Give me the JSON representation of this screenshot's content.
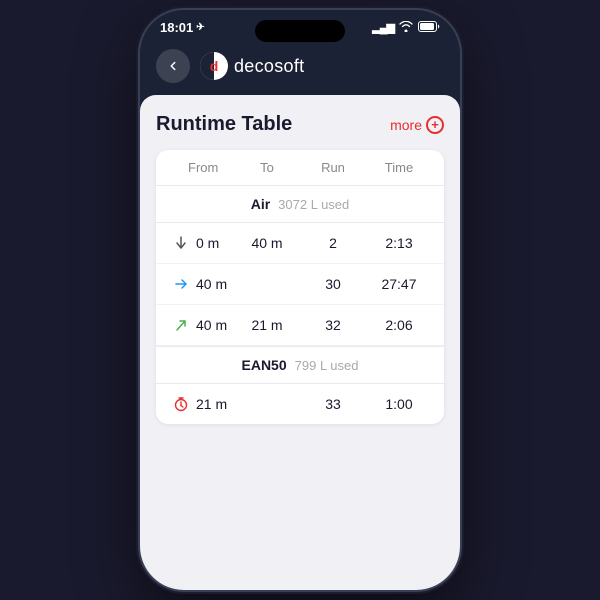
{
  "statusBar": {
    "time": "18:01",
    "timeIcon": "→",
    "signalBars": "▂▄▆",
    "wifi": "wifi",
    "battery": "battery"
  },
  "navBar": {
    "backLabel": "←",
    "logoText": "d",
    "appName": "decosoft"
  },
  "page": {
    "title": "Runtime Table",
    "moreLabel": "more",
    "morePlusIcon": "+"
  },
  "tableHeaders": {
    "col1": "From",
    "col2": "To",
    "col3": "Run",
    "col4": "Time"
  },
  "sections": [
    {
      "id": "air",
      "sectionLabel": "Air",
      "sectionSub": "3072 L used",
      "rows": [
        {
          "iconType": "down",
          "iconSymbol": "↓",
          "from": "0 m",
          "to": "40 m",
          "run": "2",
          "time": "2:13"
        },
        {
          "iconType": "right",
          "iconSymbol": "→",
          "from": "40 m",
          "to": "",
          "run": "30",
          "time": "27:47"
        },
        {
          "iconType": "ascent",
          "iconSymbol": "↗",
          "from": "40 m",
          "to": "21 m",
          "run": "32",
          "time": "2:06"
        }
      ]
    },
    {
      "id": "ean50",
      "sectionLabel": "EAN50",
      "sectionSub": "799 L used",
      "rows": [
        {
          "iconType": "timer",
          "iconSymbol": "⏱",
          "from": "21 m",
          "to": "",
          "run": "33",
          "time": "1:00"
        }
      ]
    }
  ]
}
